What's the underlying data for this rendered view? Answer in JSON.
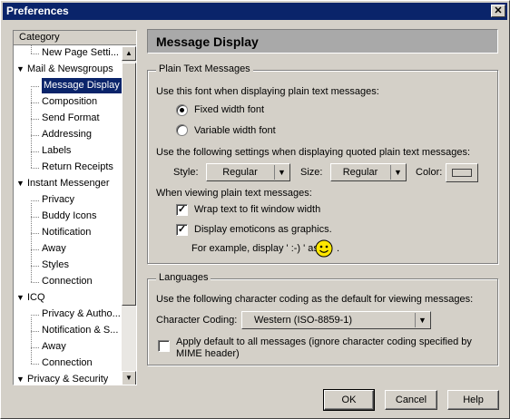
{
  "window": {
    "title": "Preferences",
    "close_label": "✕"
  },
  "tree": {
    "header": "Category",
    "items": [
      {
        "label": "New Page Setti...",
        "kind": "child"
      },
      {
        "label": "Mail & Newsgroups",
        "kind": "cat"
      },
      {
        "label": "Message Display",
        "kind": "child",
        "selected": true
      },
      {
        "label": "Composition",
        "kind": "child"
      },
      {
        "label": "Send Format",
        "kind": "child"
      },
      {
        "label": "Addressing",
        "kind": "child"
      },
      {
        "label": "Labels",
        "kind": "child"
      },
      {
        "label": "Return Receipts",
        "kind": "child"
      },
      {
        "label": "Instant Messenger",
        "kind": "cat"
      },
      {
        "label": "Privacy",
        "kind": "child"
      },
      {
        "label": "Buddy Icons",
        "kind": "child"
      },
      {
        "label": "Notification",
        "kind": "child"
      },
      {
        "label": "Away",
        "kind": "child"
      },
      {
        "label": "Styles",
        "kind": "child"
      },
      {
        "label": "Connection",
        "kind": "child"
      },
      {
        "label": "ICQ",
        "kind": "cat"
      },
      {
        "label": "Privacy & Autho...",
        "kind": "child"
      },
      {
        "label": "Notification & S...",
        "kind": "child"
      },
      {
        "label": "Away",
        "kind": "child"
      },
      {
        "label": "Connection",
        "kind": "child"
      },
      {
        "label": "Privacy & Security",
        "kind": "cat"
      }
    ]
  },
  "panel": {
    "title": "Message Display"
  },
  "plain_text": {
    "legend": "Plain Text Messages",
    "font_prompt": "Use this font when displaying plain text messages:",
    "fixed_label": "Fixed width font",
    "variable_label": "Variable width font",
    "selected_font": "fixed",
    "quoted_prompt": "Use the following settings when displaying quoted plain text messages:",
    "style_label": "Style:",
    "style_value": "Regular",
    "size_label": "Size:",
    "size_value": "Regular",
    "color_label": "Color:",
    "viewing_prompt": "When viewing plain text messages:",
    "wrap_label": "Wrap text to fit window width",
    "wrap_checked": true,
    "emoticons_label": "Display emoticons as graphics.",
    "emoticons_checked": true,
    "example_text": "For example, display ' :-) ' as",
    "example_suffix": "."
  },
  "languages": {
    "legend": "Languages",
    "prompt": "Use the following character coding as the default for viewing messages:",
    "coding_label": "Character Coding:",
    "coding_value": "Western (ISO-8859-1)",
    "apply_label_line1": "Apply default to all messages (ignore character coding specified by",
    "apply_label_line2": "MIME header)",
    "apply_checked": false
  },
  "buttons": {
    "ok": "OK",
    "cancel": "Cancel",
    "help": "Help"
  },
  "colors": {
    "titlebar": "#0a246a",
    "selection": "#0a246a",
    "face": "#d4d0c8",
    "smiley": "#ffe600"
  }
}
